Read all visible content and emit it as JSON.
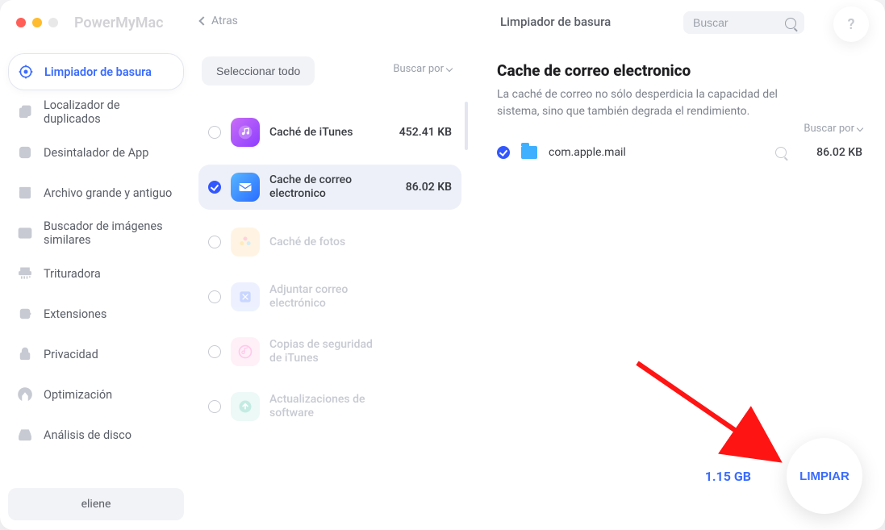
{
  "app_title": "PowerMyMac",
  "back_label": "Atras",
  "page_heading": "Limpiador de basura",
  "search_placeholder": "Buscar",
  "help_label": "?",
  "sidebar": {
    "items": [
      {
        "label": "Limpiador de basura",
        "icon": "scan",
        "active": true
      },
      {
        "label": "Localizador de duplicados",
        "icon": "dup"
      },
      {
        "label": "Desintalador de App",
        "icon": "uninstall"
      },
      {
        "label": "Archivo grande y antiguo",
        "icon": "bigfile"
      },
      {
        "label": "Buscador de imágenes similares",
        "icon": "images"
      },
      {
        "label": "Trituradora",
        "icon": "shredder"
      },
      {
        "label": "Extensiones",
        "icon": "ext"
      },
      {
        "label": "Privacidad",
        "icon": "lock"
      },
      {
        "label": "Optimización",
        "icon": "opt"
      },
      {
        "label": "Análisis de disco",
        "icon": "disk"
      }
    ],
    "user": "eliene"
  },
  "middle": {
    "select_all": "Seleccionar todo",
    "sort_by": "Buscar por",
    "categories": [
      {
        "label": "Caché de iTunes",
        "size": "452.41 KB",
        "icon": "itunes",
        "checked": false,
        "dim": false
      },
      {
        "label": "Cache de correo electronico",
        "size": "86.02 KB",
        "icon": "mail",
        "checked": true,
        "selected": true,
        "dim": false
      },
      {
        "label": "Caché de fotos",
        "size": "",
        "icon": "photos",
        "checked": false,
        "dim": true
      },
      {
        "label": "Adjuntar correo electrónico",
        "size": "",
        "icon": "attach",
        "checked": false,
        "dim": true
      },
      {
        "label": "Copias de seguridad de iTunes",
        "size": "",
        "icon": "backup",
        "checked": false,
        "dim": true
      },
      {
        "label": "Actualizaciones de software",
        "size": "",
        "icon": "update",
        "checked": false,
        "dim": true
      }
    ]
  },
  "detail": {
    "title": "Cache de correo electronico",
    "desc": "La caché de correo no sólo desperdicia la capacidad del sistema, sino que también degrada el rendimiento.",
    "sort_by": "Buscar por",
    "files": [
      {
        "name": "com.apple.mail",
        "size": "86.02 KB",
        "checked": true
      }
    ],
    "total_size": "1.15 GB",
    "clean_label": "LIMPIAR"
  }
}
